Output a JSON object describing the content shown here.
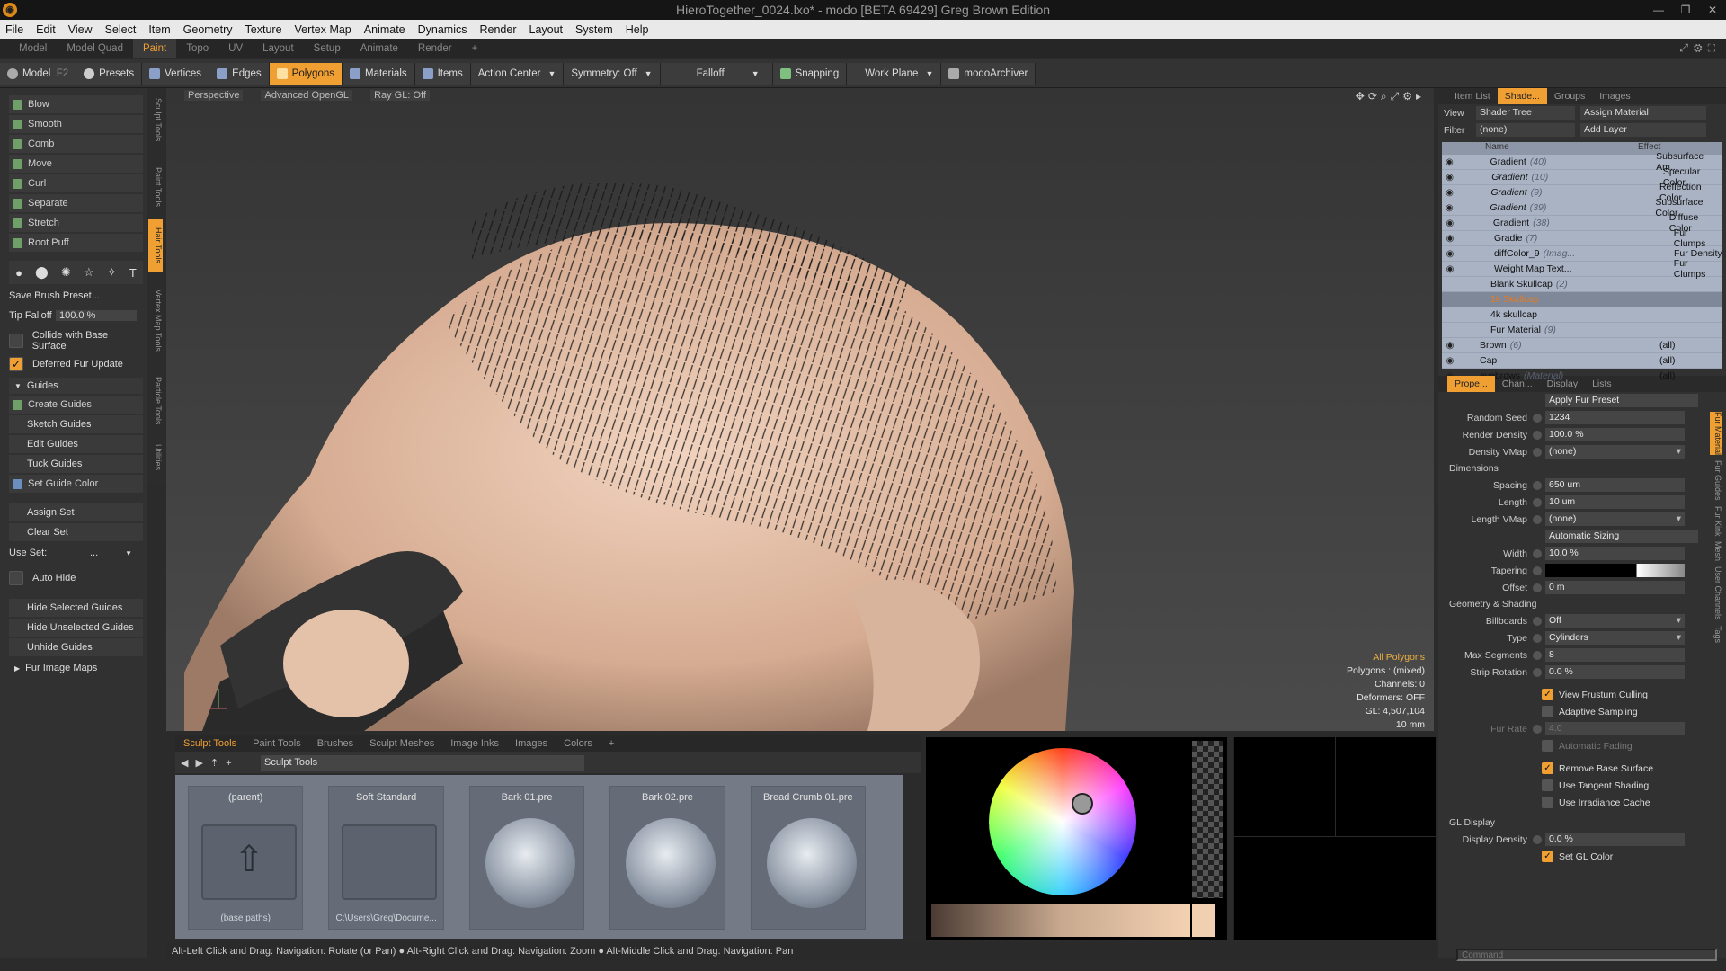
{
  "window": {
    "title": "HieroTogether_0024.lxo* - modo [BETA 69429] Greg Brown Edition"
  },
  "menu": [
    "File",
    "Edit",
    "View",
    "Select",
    "Item",
    "Geometry",
    "Texture",
    "Vertex Map",
    "Animate",
    "Dynamics",
    "Render",
    "Layout",
    "System",
    "Help"
  ],
  "layouts": {
    "tabs": [
      "Model",
      "Model Quad",
      "Paint",
      "Topo",
      "UV",
      "Layout",
      "Setup",
      "Animate",
      "Render"
    ],
    "active": "Paint"
  },
  "toolbar": {
    "model": "Model",
    "f2": "F2",
    "presets": "Presets",
    "vertices": "Vertices",
    "edges": "Edges",
    "polygons": "Polygons",
    "materials": "Materials",
    "items": "Items",
    "action_center": "Action Center",
    "symmetry": "Symmetry: Off",
    "falloff": "Falloff",
    "snapping": "Snapping",
    "work_plane": "Work Plane",
    "archiver": "modoArchiver"
  },
  "left": {
    "tools": [
      "Blow",
      "Smooth",
      "Comb",
      "Move",
      "Curl",
      "Separate",
      "Stretch",
      "Root Puff"
    ],
    "save_preset": "Save Brush Preset...",
    "tip_falloff_label": "Tip Falloff",
    "tip_falloff_value": "100.0 %",
    "collide": "Collide with Base Surface",
    "deferred": "Deferred Fur Update",
    "guides_header": "Guides",
    "guide_tools": [
      "Create Guides",
      "Sketch Guides",
      "Edit Guides",
      "Tuck Guides",
      "Set Guide Color"
    ],
    "assign_set": "Assign Set",
    "clear_set": "Clear Set",
    "use_set_label": "Use Set:",
    "use_set_value": "...",
    "auto_hide": "Auto Hide",
    "hide_selected": "Hide Selected Guides",
    "hide_unselected": "Hide Unselected Guides",
    "unhide": "Unhide Guides",
    "fur_image_maps": "Fur Image Maps",
    "vtabs": [
      "Sculpt Tools",
      "Paint Tools",
      "Hair Tools",
      "Vertex Map Tools",
      "Particle Tools",
      "Utilities"
    ]
  },
  "viewport": {
    "view": "Perspective",
    "shading": "Advanced OpenGL",
    "raygl": "Ray GL: Off",
    "info": {
      "selection": "All Polygons",
      "polygons": "Polygons : (mixed)",
      "channels": "Channels: 0",
      "deformers": "Deformers: OFF",
      "gl": "GL: 4,507,104",
      "scale": "10 mm"
    }
  },
  "bottom": {
    "tabs": [
      "Sculpt Tools",
      "Paint Tools",
      "Brushes",
      "Sculpt Meshes",
      "Image Inks",
      "Images",
      "Colors"
    ],
    "active": "Sculpt Tools",
    "dropdown": "Sculpt Tools",
    "presets": [
      {
        "title": "(parent)",
        "sub": "(base paths)",
        "kind": "folder"
      },
      {
        "title": "Soft Standard",
        "sub": "C:\\Users\\Greg\\Docume...",
        "kind": "folder"
      },
      {
        "title": "Bark 01.pre",
        "sub": "",
        "kind": "ball"
      },
      {
        "title": "Bark 02.pre",
        "sub": "",
        "kind": "ball"
      },
      {
        "title": "Bread Crumb 01.pre",
        "sub": "",
        "kind": "ball"
      }
    ]
  },
  "right": {
    "top_tabs": [
      "Item List",
      "Shade...",
      "Groups",
      "Images"
    ],
    "view_label": "View",
    "view_value": "Shader Tree",
    "assign_material": "Assign Material",
    "filter_label": "Filter",
    "filter_value": "(none)",
    "add_layer": "Add Layer",
    "col_name": "Name",
    "col_effect": "Effect",
    "shader_rows": [
      {
        "name": "Gradient",
        "note": "(40)",
        "effect": "Subsurface Am...",
        "italic": false,
        "sel": false
      },
      {
        "name": "Gradient",
        "note": "(10)",
        "effect": "Specular Color",
        "italic": true,
        "sel": false
      },
      {
        "name": "Gradient",
        "note": "(9)",
        "effect": "Reflection Color",
        "italic": true,
        "sel": false
      },
      {
        "name": "Gradient",
        "note": "(39)",
        "effect": "Subsurface Color",
        "italic": true,
        "sel": false
      },
      {
        "name": "Gradient",
        "note": "(38)",
        "effect": "Diffuse Color",
        "italic": false,
        "sel": false
      },
      {
        "name": "Gradie",
        "note": "(7)",
        "effect": "Fur Clumps",
        "italic": false,
        "sel": false
      },
      {
        "name": "diffColor_9",
        "note": "(Imag...",
        "effect": "Fur Density",
        "italic": false,
        "sel": false
      },
      {
        "name": "Weight Map Text...",
        "note": "",
        "effect": "Fur Clumps",
        "italic": false,
        "sel": false
      },
      {
        "name": "Blank Skullcap",
        "note": "(2)",
        "effect": "",
        "italic": false,
        "sel": false
      },
      {
        "name": "1k Skullcap",
        "note": "",
        "effect": "",
        "italic": false,
        "sel": true
      },
      {
        "name": "4k skullcap",
        "note": "",
        "effect": "",
        "italic": false,
        "sel": false
      },
      {
        "name": "Fur Material",
        "note": "(9)",
        "effect": "",
        "italic": false,
        "sel": false
      },
      {
        "name": "Brown",
        "note": "(6)",
        "effect": "(all)",
        "italic": false,
        "sel": false
      },
      {
        "name": "Cap",
        "note": "",
        "effect": "(all)",
        "italic": false,
        "sel": false
      },
      {
        "name": "eyebrows",
        "note": "(Material)",
        "effect": "(all)",
        "italic": false,
        "sel": false
      }
    ],
    "prop_tabs": [
      "Prope...",
      "Chan...",
      "Display",
      "Lists"
    ],
    "apply_preset": "Apply Fur Preset",
    "props1": [
      {
        "label": "Random Seed",
        "value": "1234",
        "dd": false
      },
      {
        "label": "Render Density",
        "value": "100.0 %",
        "dd": false
      },
      {
        "label": "Density VMap",
        "value": "(none)",
        "dd": true
      }
    ],
    "dimensions": "Dimensions",
    "props2": [
      {
        "label": "Spacing",
        "value": "650 um",
        "dd": false
      },
      {
        "label": "Length",
        "value": "10 um",
        "dd": false
      },
      {
        "label": "Length VMap",
        "value": "(none)",
        "dd": true
      }
    ],
    "auto_sizing": "Automatic Sizing",
    "width_label": "Width",
    "width_value": "10.0 %",
    "tapering_label": "Tapering",
    "offset_label": "Offset",
    "offset_value": "0 m",
    "geo_shading": "Geometry & Shading",
    "props3": [
      {
        "label": "Billboards",
        "value": "Off",
        "dd": true
      },
      {
        "label": "Type",
        "value": "Cylinders",
        "dd": true
      },
      {
        "label": "Max Segments",
        "value": "8",
        "dd": false
      },
      {
        "label": "Strip Rotation",
        "value": "0.0 %",
        "dd": false
      }
    ],
    "checks1": [
      {
        "label": "View Frustum Culling",
        "on": true
      },
      {
        "label": "Adaptive Sampling",
        "on": false
      }
    ],
    "fur_rate_label": "Fur Rate",
    "fur_rate_value": "4.0",
    "auto_fading": "Automatic Fading",
    "checks2": [
      {
        "label": "Remove Base Surface",
        "on": true
      },
      {
        "label": "Use Tangent Shading",
        "on": false
      },
      {
        "label": "Use Irradiance Cache",
        "on": false
      }
    ],
    "gl_display": "GL Display",
    "display_density_label": "Display Density",
    "display_density_value": "0.0 %",
    "set_gl_color": "Set GL Color",
    "side_tabs": [
      "Fur Material",
      "Fur Guides",
      "Fur Kink",
      "Mesh",
      "User Channels",
      "Tags"
    ],
    "command_placeholder": "Command"
  },
  "status": "Alt-Left Click and Drag: Navigation: Rotate (or Pan) ● Alt-Right Click and Drag: Navigation: Zoom ● Alt-Middle Click and Drag: Navigation: Pan"
}
